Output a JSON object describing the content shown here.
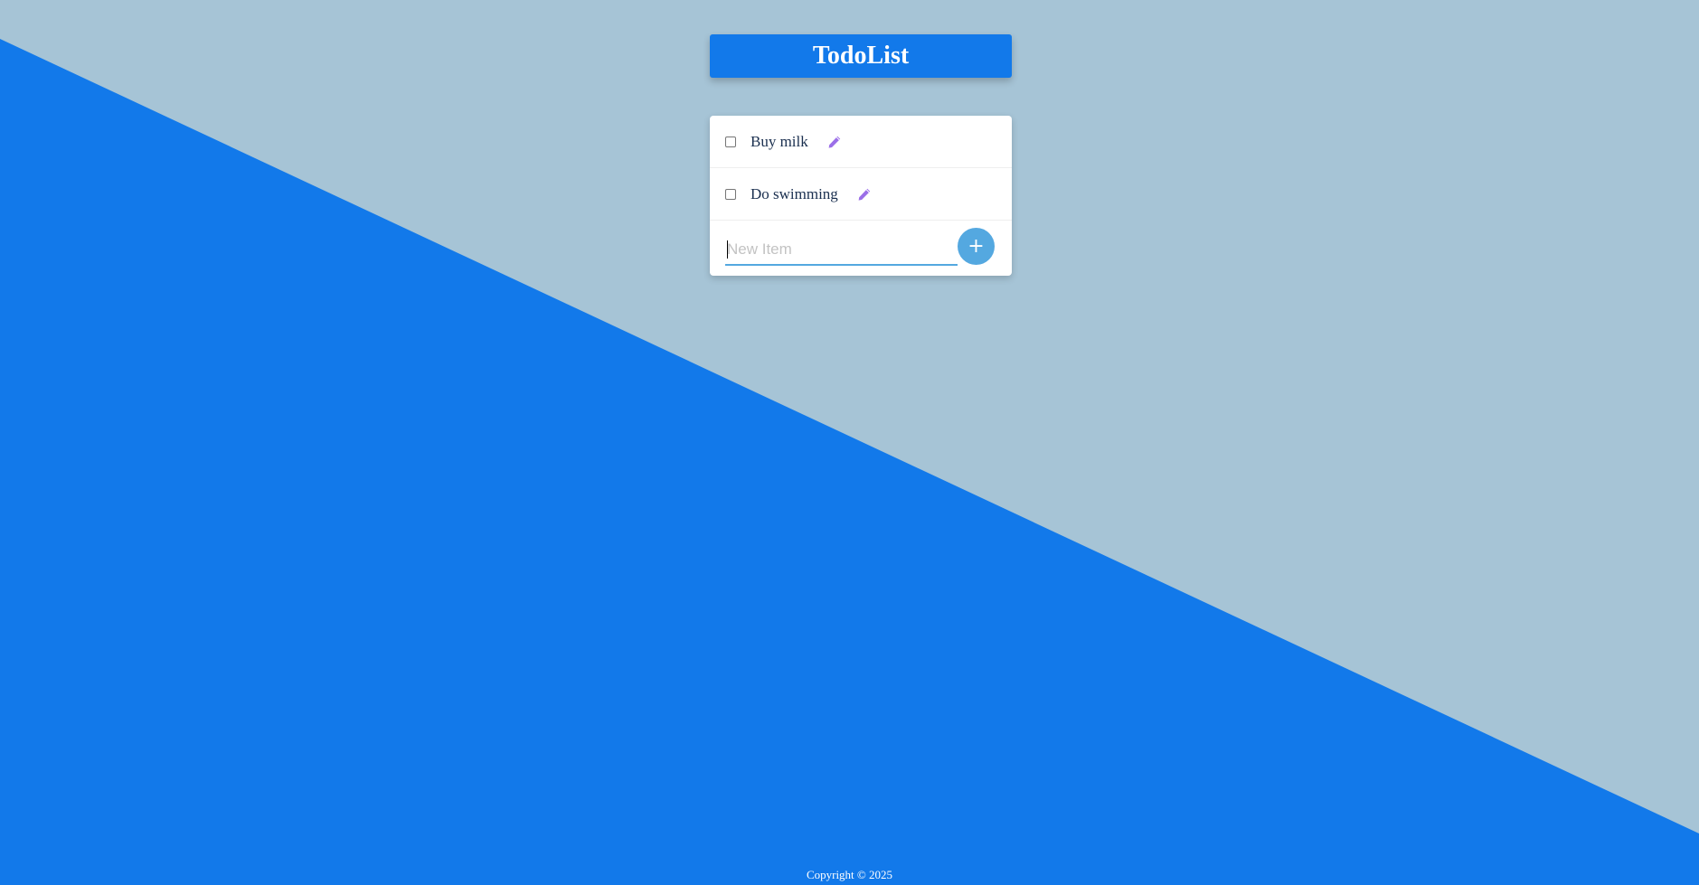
{
  "app": {
    "title": "TodoList"
  },
  "todo_items": [
    {
      "label": "Buy milk",
      "checked": false,
      "edit_icon": "pencil-icon"
    },
    {
      "label": "Do swimming",
      "checked": false,
      "edit_icon": "pencil-icon"
    }
  ],
  "new_item": {
    "placeholder": "New Item",
    "value": "",
    "add_label": "+"
  },
  "footer": {
    "text": "Copyright © 2025"
  },
  "colors": {
    "accent": "#1279ea",
    "background_light": "#a6c4d6",
    "input_accent": "#54a8e0",
    "edit_icon": "#9b6fe8",
    "item_text": "#1a2f4f"
  }
}
